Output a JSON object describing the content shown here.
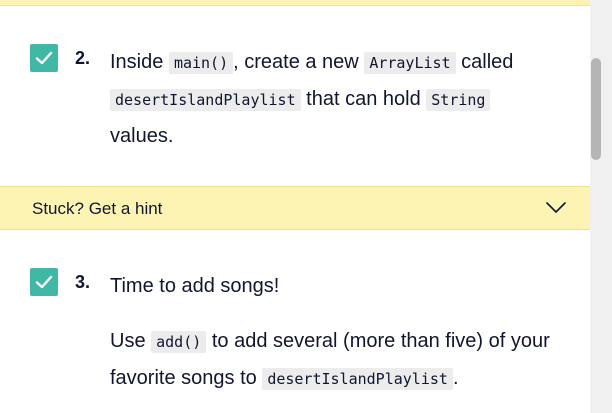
{
  "task2": {
    "number": "2.",
    "t1": "Inside ",
    "c1": "main()",
    "t2": ", create a new ",
    "c2": "ArrayList",
    "t3": " called",
    "c3": "desertIslandPlaylist",
    "t4": " that can hold ",
    "c4": "String",
    "t5": "values."
  },
  "hint": {
    "label": "Stuck? Get a hint"
  },
  "task3": {
    "number": "3.",
    "title": "Time to add songs!",
    "p1": "Use ",
    "c1": "add()",
    "p2": " to add several (more than five) of your favorite songs to ",
    "c2": "desertIslandPlaylist",
    "p3": "."
  },
  "icons": {
    "check": "checkmark-icon",
    "chevron": "chevron-down-icon"
  },
  "colors": {
    "checkbox": "#3fb9a6",
    "hint_bg": "#fdf3b2",
    "text": "#10162f"
  }
}
